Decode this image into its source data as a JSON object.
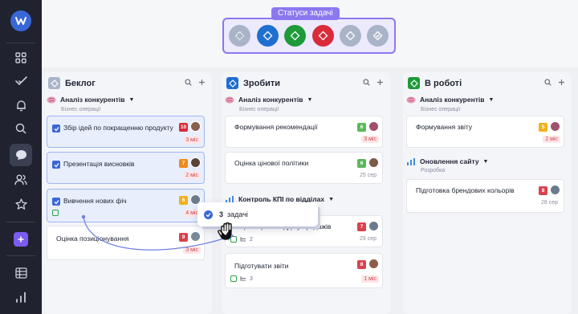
{
  "status_popup": {
    "label": "Статуси задачі",
    "circles": [
      {
        "icon": "diamond-icon",
        "color": "#a9b4c8"
      },
      {
        "icon": "diamond-icon",
        "color": "#1f6fd0"
      },
      {
        "icon": "diamond-icon",
        "color": "#1e9a3b"
      },
      {
        "icon": "diamond-icon",
        "color": "#d92c3a"
      },
      {
        "icon": "diamond-icon",
        "color": "#a9b4c8"
      },
      {
        "icon": "diamond-check-icon",
        "color": "#a9b4c8"
      }
    ]
  },
  "columns": [
    {
      "title": "Беклог",
      "color": "#a9b4c8",
      "groups": [
        {
          "name": "Аналіз конкурентів",
          "sub": "Бізнес операції",
          "cards": [
            {
              "title": "Збір ідей по покращенню продукту",
              "checked": true,
              "prio": "10",
              "prio_color": "#d92c3a",
              "due": "3 міс",
              "due_red": true,
              "selected": true
            },
            {
              "title": "Презентація висновків",
              "checked": true,
              "prio": "7",
              "prio_color": "#f08a1c",
              "due": "2 міс",
              "due_red": true,
              "selected": true
            },
            {
              "title": "Вивчення нових фіч",
              "checked": true,
              "prio": "6",
              "prio_color": "#f0b11c",
              "due": "4 міс",
              "due_red": true,
              "selected": true
            },
            {
              "title": "Оцінка позиціонування",
              "checked": false,
              "prio": "9",
              "prio_color": "#d9434e",
              "due": "3 міс",
              "due_red": true,
              "selected": false
            }
          ]
        }
      ]
    },
    {
      "title": "Зробити",
      "color": "#1f6fd0",
      "groups": [
        {
          "name": "Аналіз конкурентів",
          "sub": "Бізнес операції",
          "cards": [
            {
              "title": "Формування рекомендації",
              "prio": "6",
              "prio_color": "#5cb85c",
              "due": "3 міс",
              "due_red": true
            },
            {
              "title": "Оцінка цінової політики",
              "prio": "6",
              "prio_color": "#5cb85c",
              "due": "25 сер",
              "due_red": false
            }
          ]
        },
        {
          "name": "Контроль КПІ по відділах",
          "cards": [
            {
              "title": "Збір метрик з відділу продажів",
              "prio": "7",
              "prio_color": "#d9434e",
              "due": "29 сер",
              "due_red": false,
              "subtasks": "2"
            },
            {
              "title": "Підготувати звіти",
              "prio": "8",
              "prio_color": "#d9434e",
              "due": "1 міс",
              "due_red": true,
              "subtasks": "3"
            }
          ]
        }
      ]
    },
    {
      "title": "В роботі",
      "color": "#1e9a3b",
      "groups": [
        {
          "name": "Аналіз конкурентів",
          "sub": "Бізнес операції",
          "cards": [
            {
              "title": "Формування звіту",
              "prio": "5",
              "prio_color": "#f0b11c",
              "due": "2 міс",
              "due_red": true
            }
          ]
        },
        {
          "name": "Оновлення сайту",
          "sub": "Розробка",
          "cards": [
            {
              "title": "Підготовка брендових кольорів",
              "prio": "8",
              "prio_color": "#d9434e",
              "due": "28 сер",
              "due_red": false
            }
          ]
        }
      ]
    }
  ],
  "drag": {
    "count": "3",
    "label": "задачі"
  },
  "rail_icons": [
    "apps-icon",
    "check-icon",
    "bell-icon",
    "search-icon",
    "chat-icon",
    "users-icon",
    "star-icon",
    "add-icon",
    "table-icon",
    "chart-icon"
  ]
}
